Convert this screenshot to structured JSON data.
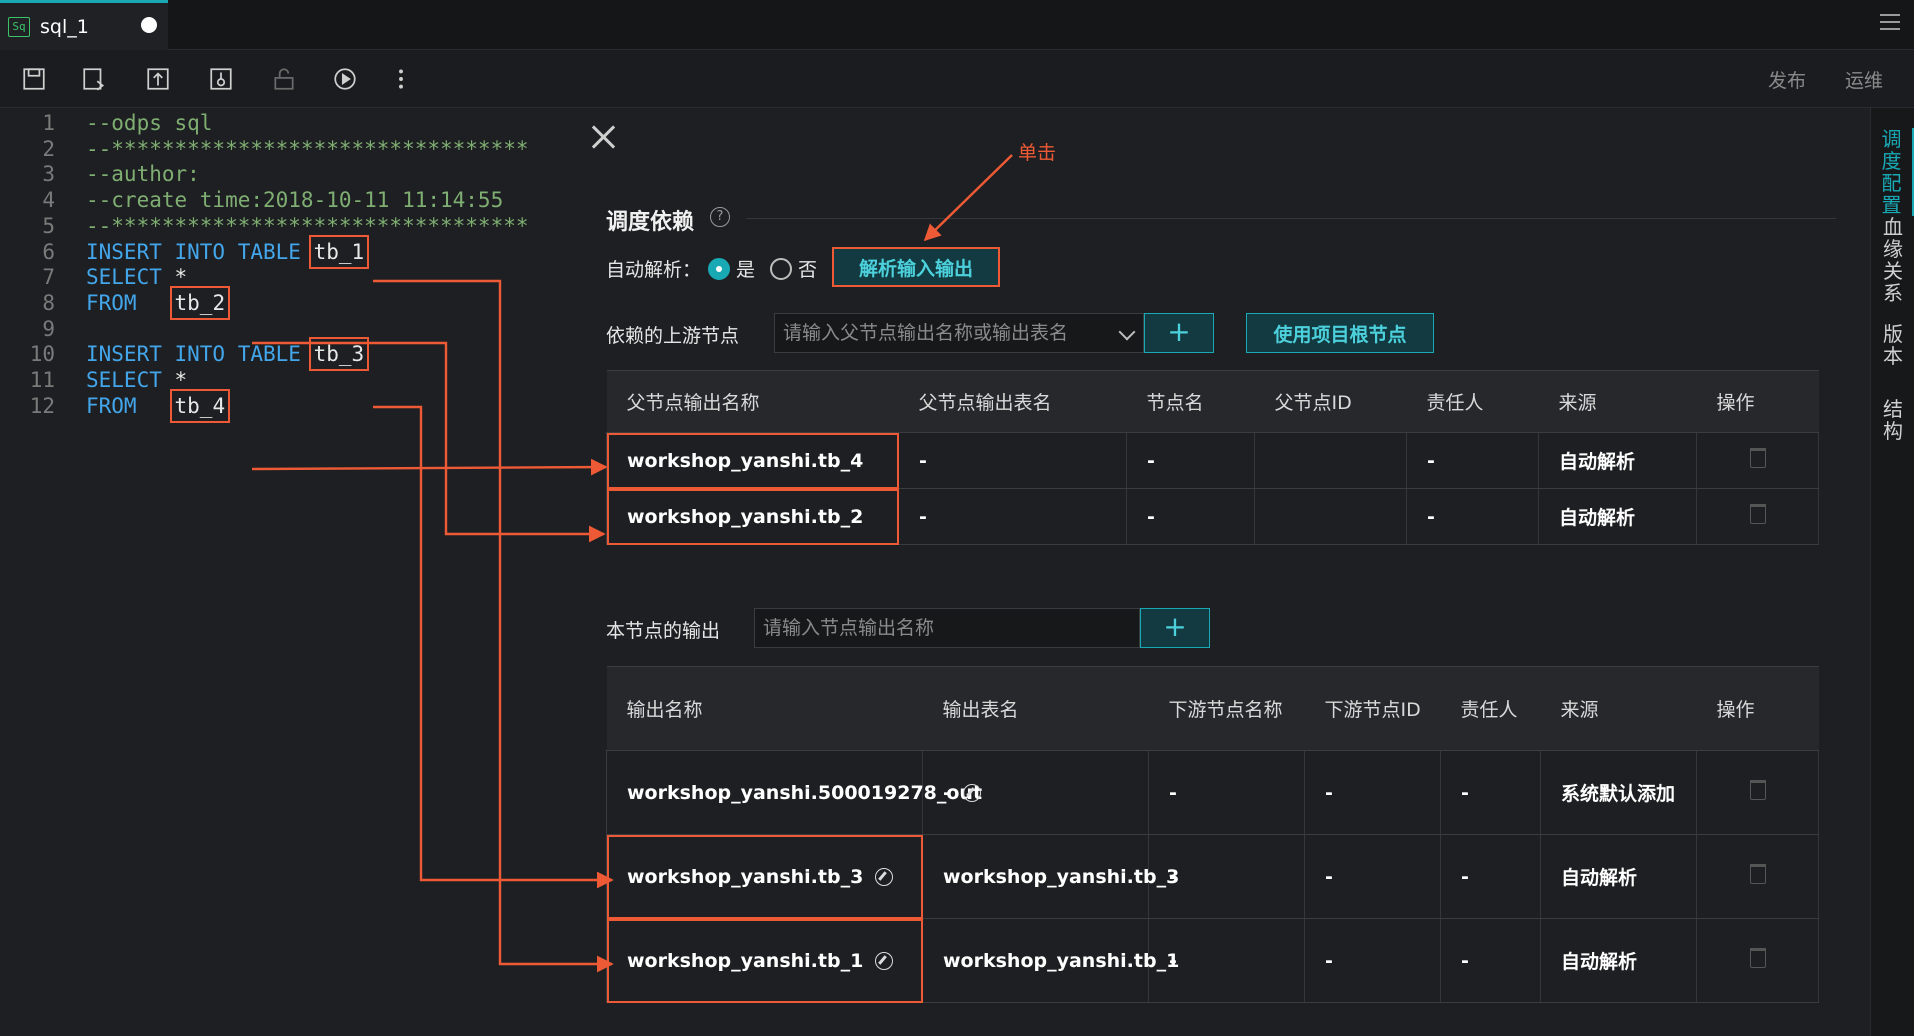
{
  "tab": {
    "icon": "Sq",
    "title": "sql_1"
  },
  "toolbar": {
    "publish": "发布",
    "ops": "运维"
  },
  "editor": {
    "lines": [
      {
        "n": "1",
        "parts": [
          {
            "t": "--odps sql",
            "c": "cm"
          }
        ]
      },
      {
        "n": "2",
        "parts": [
          {
            "t": "--*********************************",
            "c": "cm"
          }
        ]
      },
      {
        "n": "3",
        "parts": [
          {
            "t": "--author:",
            "c": "cm"
          }
        ]
      },
      {
        "n": "4",
        "parts": [
          {
            "t": "--create time:2018-10-11 11:14:55",
            "c": "cm"
          }
        ]
      },
      {
        "n": "5",
        "parts": [
          {
            "t": "--*********************************",
            "c": "cm"
          }
        ]
      },
      {
        "n": "6",
        "parts": [
          {
            "t": "INSERT INTO TABLE ",
            "c": "kw"
          },
          {
            "t": "tb_1",
            "c": "id hl"
          }
        ]
      },
      {
        "n": "7",
        "parts": [
          {
            "t": "SELECT ",
            "c": "kw"
          },
          {
            "t": "*",
            "c": "id"
          }
        ]
      },
      {
        "n": "8",
        "parts": [
          {
            "t": "FROM   ",
            "c": "kw"
          },
          {
            "t": "tb_2",
            "c": "id hl"
          }
        ]
      },
      {
        "n": "9",
        "parts": []
      },
      {
        "n": "10",
        "parts": [
          {
            "t": "INSERT INTO TABLE ",
            "c": "kw"
          },
          {
            "t": "tb_3",
            "c": "id hl"
          }
        ]
      },
      {
        "n": "11",
        "parts": [
          {
            "t": "SELECT ",
            "c": "kw"
          },
          {
            "t": "*",
            "c": "id"
          }
        ]
      },
      {
        "n": "12",
        "parts": [
          {
            "t": "FROM   ",
            "c": "kw"
          },
          {
            "t": "tb_4",
            "c": "id hl"
          }
        ]
      }
    ]
  },
  "rtabs": [
    "调度配置",
    "血缘关系",
    "版本",
    "结构"
  ],
  "panel": {
    "title": "调度依赖",
    "auto_parse_label": "自动解析：",
    "yes": "是",
    "no": "否",
    "parse_btn": "解析输入输出",
    "annotation": "单击",
    "upstream_label": "依赖的上游节点",
    "upstream_placeholder": "请输入父节点输出名称或输出表名",
    "plus": "+",
    "root_btn": "使用项目根节点",
    "upstream_table": {
      "headers": [
        "父节点输出名称",
        "父节点输出表名",
        "节点名",
        "父节点ID",
        "责任人",
        "来源",
        "操作"
      ],
      "rows": [
        [
          "workshop_yanshi.tb_4",
          "-",
          "-",
          "",
          "-",
          "自动解析"
        ],
        [
          "workshop_yanshi.tb_2",
          "-",
          "-",
          "",
          "-",
          "自动解析"
        ]
      ]
    },
    "output_label": "本节点的输出",
    "output_placeholder": "请输入节点输出名称",
    "output_table": {
      "headers": [
        "输出名称",
        "输出表名",
        "下游节点名称",
        "下游节点ID",
        "责任人",
        "来源",
        "操作"
      ],
      "rows": [
        [
          "workshop_yanshi.500019278_out",
          "-",
          "-",
          "-",
          "-",
          "系统默认添加"
        ],
        [
          "workshop_yanshi.tb_3",
          "workshop_yanshi.tb_3",
          "-",
          "-",
          "-",
          "自动解析"
        ],
        [
          "workshop_yanshi.tb_1",
          "workshop_yanshi.tb_1",
          "-",
          "-",
          "-",
          "自动解析"
        ]
      ]
    }
  },
  "colors": {
    "accent": "#18a9b5",
    "annotation": "#ee5a35"
  }
}
